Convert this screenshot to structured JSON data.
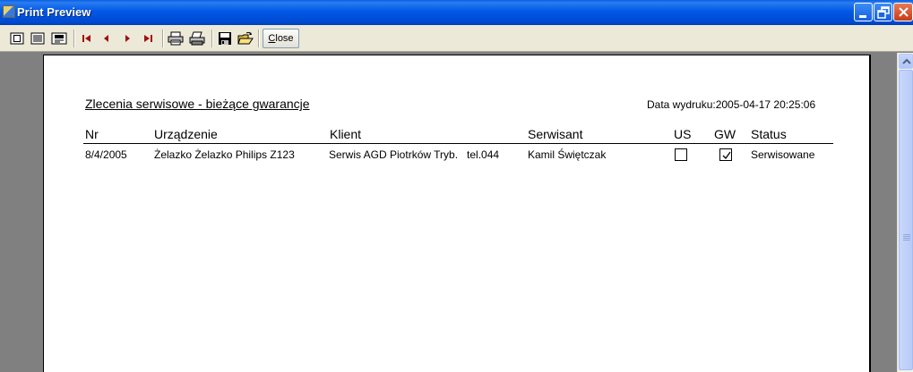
{
  "window": {
    "title": "Print Preview",
    "app_icon": "report-app-icon",
    "controls": [
      "minimize-icon",
      "restore-icon",
      "close-icon"
    ]
  },
  "toolbar": {
    "icons": [
      "one-page-icon",
      "multi-page-icon",
      "page-setup-icon",
      "first-page-icon",
      "prev-page-icon",
      "next-page-icon",
      "last-page-icon",
      "print-setup-icon",
      "print-icon",
      "save-icon",
      "open-icon"
    ],
    "close_label_underlined": "C",
    "close_label_rest": "lose"
  },
  "report": {
    "title": "Zlecenia serwisowe - bieżące gwarancje",
    "print_date": "Data wydruku:2005-04-17 20:25:06",
    "columns": {
      "nr": "Nr",
      "device": "Urządzenie",
      "client": "Klient",
      "technician": "Serwisant",
      "us": "US",
      "gw": "GW",
      "status": "Status"
    },
    "rows": [
      {
        "nr": "8/4/2005",
        "device": "Żelazko Żelazko Philips Z123",
        "client": "Serwis AGD Piotrków Tryb.   tel.044",
        "technician": "Kamil Świętczak",
        "us": false,
        "gw": true,
        "status": "Serwisowane"
      }
    ]
  },
  "colors": {
    "titlebar": "#0058e6",
    "toolbar": "#ece9d8",
    "workspace": "#808080",
    "page": "#ffffff",
    "nav_arrows": "#a01010"
  }
}
